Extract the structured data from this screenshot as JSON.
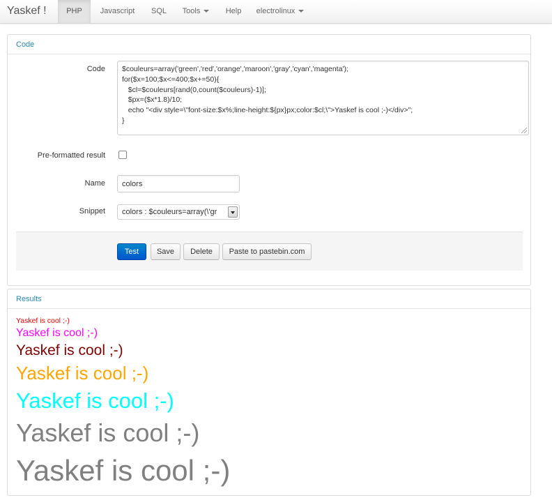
{
  "navbar": {
    "brand": "Yaskef !",
    "items": [
      {
        "label": "PHP",
        "active": true,
        "dropdown": false
      },
      {
        "label": "Javascript",
        "active": false,
        "dropdown": false
      },
      {
        "label": "SQL",
        "active": false,
        "dropdown": false
      },
      {
        "label": "Tools",
        "active": false,
        "dropdown": true
      },
      {
        "label": "Help",
        "active": false,
        "dropdown": false
      },
      {
        "label": "electrolinux",
        "active": false,
        "dropdown": true
      }
    ]
  },
  "code_panel": {
    "heading": "Code",
    "code_label": "Code",
    "code_lines": [
      "$couleurs=array('green','red','orange','maroon','gray','cyan','magenta');",
      "for($x=100;$x<=400;$x+=50){",
      "   $cl=$couleurs[rand(0,count($couleurs)-1)];",
      "   $px=($x*1.8)/10;",
      "   echo \"<div style=\\\"font-size:$x%;line-height:${px}px;color:$cl;\\\">Yaskef is cool ;-)</div>\";",
      "}"
    ],
    "preformatted_label": "Pre-formatted result",
    "preformatted_checked": false,
    "name_label": "Name",
    "name_value": "colors",
    "snippet_label": "Snippet",
    "snippet_value": "colors : $couleurs=array(\\'gr",
    "buttons": {
      "test": "Test",
      "save": "Save",
      "delete": "Delete",
      "paste": "Paste to pastebin.com"
    }
  },
  "results_panel": {
    "heading": "Results",
    "lines": [
      {
        "text": "Yaskef is cool ;-)",
        "color": "#ff0000"
      },
      {
        "text": "Yaskef is cool ;-)",
        "color": "#ff00ff"
      },
      {
        "text": "Yaskef is cool ;-)",
        "color": "#800000"
      },
      {
        "text": "Yaskef is cool ;-)",
        "color": "#ffa500"
      },
      {
        "text": "Yaskef is cool ;-)",
        "color": "#00ffff"
      },
      {
        "text": "Yaskef is cool ;-)",
        "color": "#808080"
      },
      {
        "text": "Yaskef is cool ;-)",
        "color": "#808080"
      }
    ]
  },
  "colors": {
    "link_blue": "#2a8ab5",
    "primary_button": "#0066cc"
  }
}
